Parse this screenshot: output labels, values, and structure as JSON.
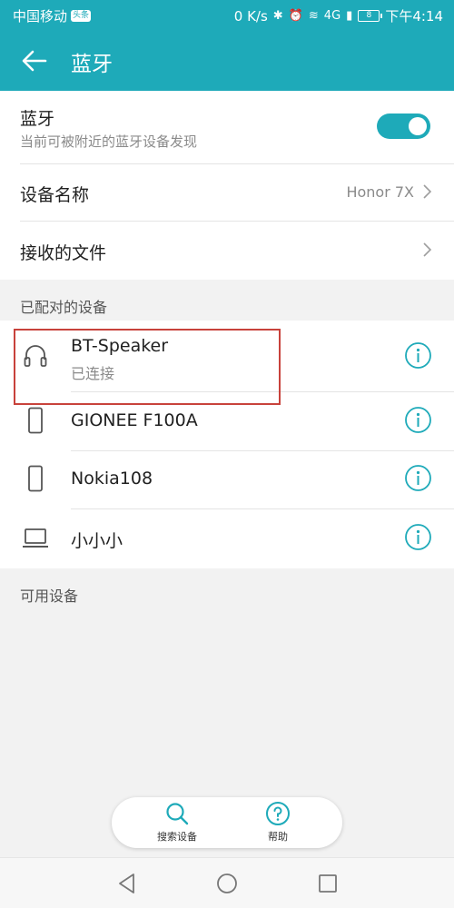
{
  "status_bar": {
    "carrier": "中国移动",
    "carrier_badge": "头条",
    "speed": "0 K/s",
    "network": "4G",
    "battery": "8",
    "time": "下午4:14"
  },
  "app_bar": {
    "title": "蓝牙"
  },
  "bluetooth": {
    "label": "蓝牙",
    "description": "当前可被附近的蓝牙设备发现",
    "enabled": true
  },
  "device_name": {
    "label": "设备名称",
    "value": "Honor 7X"
  },
  "received_files": {
    "label": "接收的文件"
  },
  "paired_section": {
    "title": "已配对的设备",
    "devices": [
      {
        "name": "BT-Speaker",
        "status": "已连接",
        "icon": "headphones-icon"
      },
      {
        "name": "GIONEE F100A",
        "icon": "phone-icon"
      },
      {
        "name": "Nokia108",
        "icon": "phone-icon"
      },
      {
        "name": "小小小",
        "icon": "laptop-icon"
      }
    ]
  },
  "available_section": {
    "title": "可用设备"
  },
  "bottom_bar": {
    "search_label": "搜索设备",
    "help_label": "帮助"
  },
  "colors": {
    "accent": "#1eaab9",
    "highlight": "#c8423b"
  }
}
